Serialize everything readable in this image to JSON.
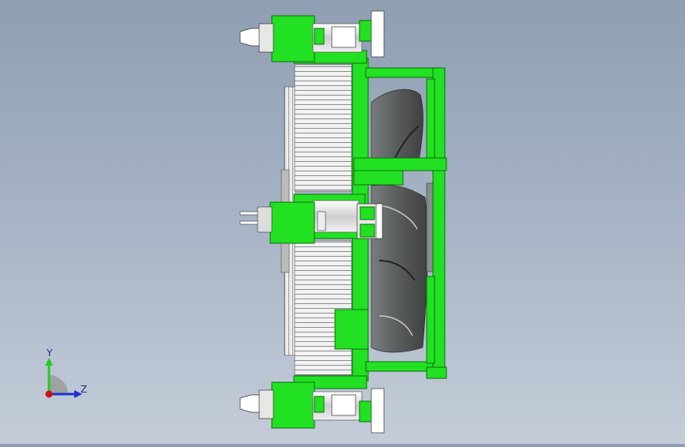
{
  "viewport": {
    "background_top": "#8f9eb3",
    "background_bottom": "#c4ccd8",
    "part_color": "#22e022",
    "part_color_dark": "#0b8f0b",
    "fin_color": "#e6e6e6",
    "blade_color": "#5f6263"
  },
  "triad": {
    "y_label": "Y",
    "z_label": "Z",
    "y_color": "#22cc22",
    "z_color": "#2030d0",
    "x_color": "#d01010"
  }
}
